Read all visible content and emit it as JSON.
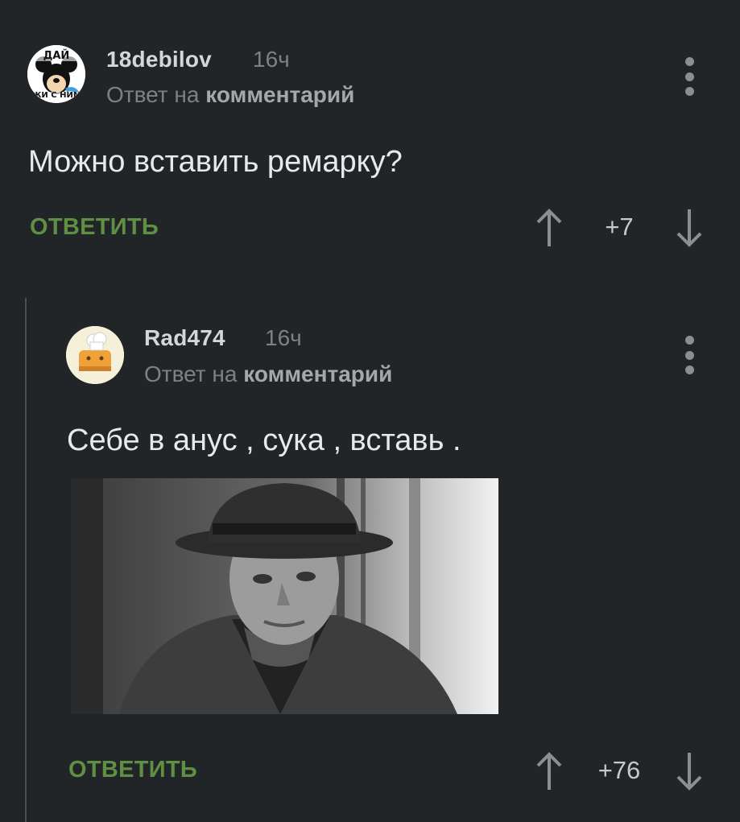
{
  "comments": [
    {
      "username": "18debilov",
      "time": "16ч",
      "reply_prefix": "Ответ на",
      "reply_target": "комментарий",
      "avatar_text": [
        "ДАЙ",
        "ЖИ С НИМ"
      ],
      "text": "Можно вставить ремарку?",
      "reply_label": "ОТВЕТИТЬ",
      "score": "+7"
    },
    {
      "username": "Rad474",
      "time": "16ч",
      "reply_prefix": "Ответ на",
      "reply_target": "комментарий",
      "text": "Себе в анус , сука , вставь .",
      "reply_label": "ОТВЕТИТЬ",
      "score": "+76"
    }
  ],
  "colors": {
    "background": "#222528",
    "accent_reply": "#5f8f43",
    "muted_text": "#7d8185",
    "thread_line": "#4a4d50"
  },
  "icons": {
    "more": "vertical-dots-icon",
    "upvote": "arrow-up-icon",
    "downvote": "arrow-down-icon"
  }
}
